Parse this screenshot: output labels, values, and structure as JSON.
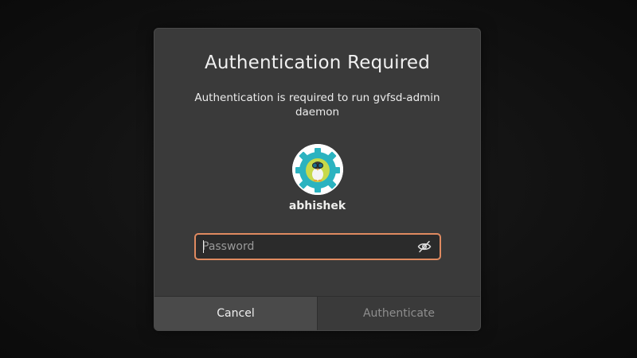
{
  "dialog": {
    "title": "Authentication Required",
    "message": "Authentication is required to run gvfsd-admin daemon",
    "user": {
      "name": "abhishek",
      "avatar_icon": "user-avatar-gear-icon"
    },
    "password": {
      "value": "",
      "placeholder": "Password",
      "reveal_icon": "eye-slash-icon"
    },
    "buttons": {
      "cancel_label": "Cancel",
      "authenticate_label": "Authenticate"
    }
  },
  "colors": {
    "dialog_bg": "#3a3a3a",
    "field_focus_border": "#e08a60",
    "disabled_text": "#8e8e8e",
    "avatar_gear": "#2bb3c0"
  }
}
